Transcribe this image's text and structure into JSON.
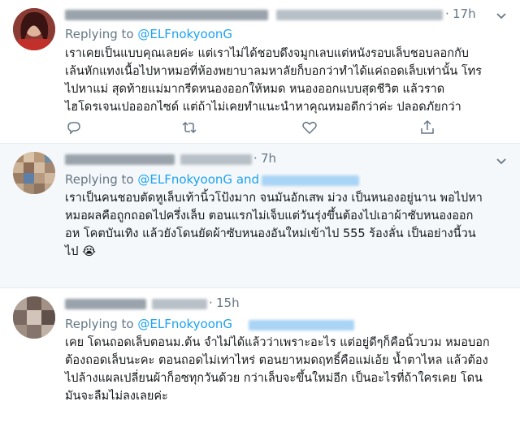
{
  "tweets": [
    {
      "time": "17h",
      "replying_prefix": "Replying to",
      "replying_handle": "@ELFnokyoonG",
      "lines": [
        "เราเคยเป็นแบบคุณเลยค่ะ แต่เราไม่ได้ชอบดึงจมูกเลบแต่หนังรอบเล็บชอบลอกกับ",
        "เล้นหักแทงเนื้อไปหาหมอที่ห้องพยาบาลมหาลัยก็บอกว่าทำได้แค่ถอดเล็บเท่านั้น โทร",
        "ไปหาแม่ สุดท้ายแม่มากรีดหนองออกให้หมด หนองออกแบบสุดชีวิต แล้วราด",
        "ไฮโดรเจนเปอออกไซด์ แต่ถ้าไม่เคยทำแนะนำหาคุณหมอดีกว่าค่ะ ปลอดภัยกว่า"
      ]
    },
    {
      "time": "7h",
      "replying_prefix": "Replying to",
      "replying_handle": "@ELFnokyoonG",
      "replying_and": "and",
      "lines": [
        "เราเป็นคนชอบตัดหูเล็บเท้านิ้วโป้งมาก จนมันอักเสพ ม่วง เป็นหนองอยู่นาน พอไปหา",
        "หมอผลคือถูกถอดไปครึ่งเล็บ ตอนแรกไม่เจ็บแต่วันรุ่งขึ้นต้องไปเอาผ้าซับหนองออก",
        "อห โคตบันเทิง แล้วยังโดนยัดผ้าซับหนองอันใหม่เข้าไป 555 ร้องลั่น เป็นอย่างนี้วน",
        "ไป"
      ],
      "emoji": "😭"
    },
    {
      "time": "15h",
      "replying_prefix": "Replying to",
      "replying_handle": "@ELFnokyoonG",
      "lines": [
        "เคย โดนถอดเล็บตอนม.ต้น จำไม่ได้แล้วว่าเพราะอะไร แต่อยู่ดีๆก็คือนิ้วบวม หมอบอก",
        "ต้องถอดเล็บนะคะ ตอนถอดไม่เท่าไหร่ ตอนยาหมดฤทธิ์คือแม่เอ้ย น้ำตาไหล แล้วต้อง",
        "ไปล้างแผลเปลี่ยนผ้าก็อซทุกวันด้วย กว่าเล็บจะขึ้นใหม่อีก เป็นอะไรที่ถ้าใครเคย โดน",
        "มันจะลืมไม่ลงเลยค่ะ"
      ]
    }
  ]
}
